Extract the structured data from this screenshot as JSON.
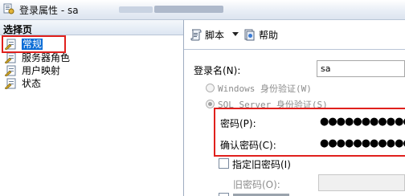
{
  "window": {
    "title": "登录属性 - sa"
  },
  "left_pane": {
    "header": "选择页",
    "items": [
      {
        "label": "常规",
        "icon": "page-wrench-icon",
        "selected": true
      },
      {
        "label": "服务器角色",
        "icon": "page-wrench-icon",
        "selected": false
      },
      {
        "label": "用户映射",
        "icon": "page-wrench-icon",
        "selected": false
      },
      {
        "label": "状态",
        "icon": "page-wrench-icon",
        "selected": false
      }
    ]
  },
  "toolbar": {
    "script_label": "脚本",
    "help_label": "帮助"
  },
  "form": {
    "login_name_label": "登录名(N):",
    "login_name_value": "sa",
    "windows_auth_label": "Windows 身份验证(W)",
    "sql_auth_label": "SQL Server 身份验证(S)",
    "password_label": "密码(P):",
    "password_value": "●●●●●●●●●●●●●●",
    "confirm_password_label": "确认密码(C):",
    "confirm_password_value": "●●●●●●●●●●●●●●",
    "specify_old_password_label": "指定旧密码(I)",
    "old_password_label": "旧密码(O):"
  },
  "colors": {
    "selection": "#0a6cd6",
    "highlight_box": "#e0201d"
  }
}
